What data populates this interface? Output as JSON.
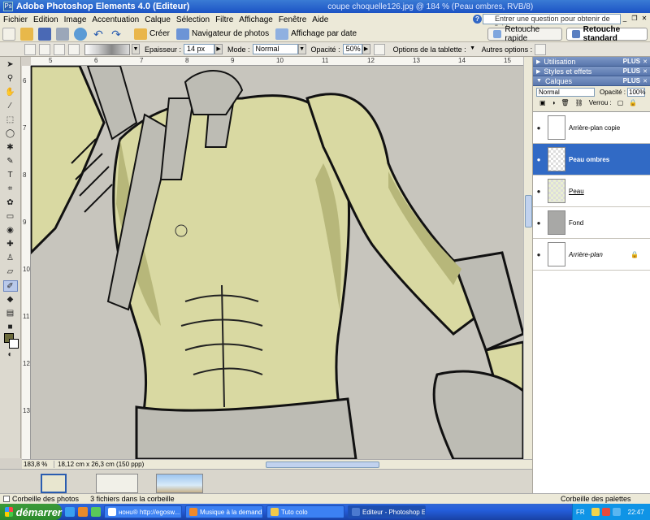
{
  "window": {
    "app_title": "Adobe Photoshop Elements 4.0 (Editeur)",
    "doc_title": "coupe choquelle126.jpg @ 184 % (Peau ombres, RVB/8)"
  },
  "menu": [
    "Fichier",
    "Edition",
    "Image",
    "Accentuation",
    "Calque",
    "Sélection",
    "Filtre",
    "Affichage",
    "Fenêtre",
    "Aide"
  ],
  "help": {
    "placeholder": "Entrer une question pour obtenir de l'aide"
  },
  "shortcuts": {
    "create": "Créer",
    "photo_browser": "Navigateur de photos",
    "date_view": "Affichage par date",
    "quick_fix": "Retouche rapide",
    "standard_edit": "Retouche standard"
  },
  "options": {
    "thickness_label": "Epaisseur :",
    "thickness_value": "14 px",
    "mode_label": "Mode :",
    "mode_value": "Normal",
    "opacity_label": "Opacité :",
    "opacity_value": "50%",
    "tablet_label": "Options de la tablette :",
    "other_label": "Autres options :"
  },
  "rulers": {
    "top": [
      "5",
      "6",
      "7",
      "8",
      "9",
      "10",
      "11",
      "12",
      "13",
      "14",
      "15"
    ],
    "left": [
      "6",
      "7",
      "8",
      "9",
      "10",
      "11",
      "12",
      "13"
    ]
  },
  "status": {
    "zoom": "183,8 %",
    "dimensions": "18,12 cm x 26,3 cm (150 ppp)"
  },
  "bins": {
    "photo_bin": "Corbeille des photos",
    "files_count": "3 fichiers dans la corbeille",
    "palette_bin": "Corbeille des palettes"
  },
  "panels": {
    "utilisation": "Utilisation",
    "styles": "Styles et effets",
    "calques": "Calques",
    "plus": "PLUS",
    "blend_mode": "Normal",
    "opacity_label": "Opacité :",
    "opacity_value": "100%",
    "lock_label": "Verrou :"
  },
  "layers": [
    {
      "name": "Arrière-plan copie",
      "selected": false
    },
    {
      "name": "Peau ombres",
      "selected": true
    },
    {
      "name": "Peau",
      "selected": false
    },
    {
      "name": "Fond",
      "selected": false
    },
    {
      "name": "Arrière-plan",
      "selected": false
    }
  ],
  "taskbar": {
    "start": "démarrer",
    "tasks": [
      "нoнu® http://egosw...",
      "Musique à la demand...",
      "Tuto colo",
      "Editeur - Photoshop E..."
    ],
    "lang": "FR",
    "time": "22:47"
  },
  "colors": {
    "skin": "#d9d9a2",
    "skin_shadow": "#b7b77a",
    "background_canvas": "#c7c5bd",
    "selected_layer": "#316ac5"
  }
}
